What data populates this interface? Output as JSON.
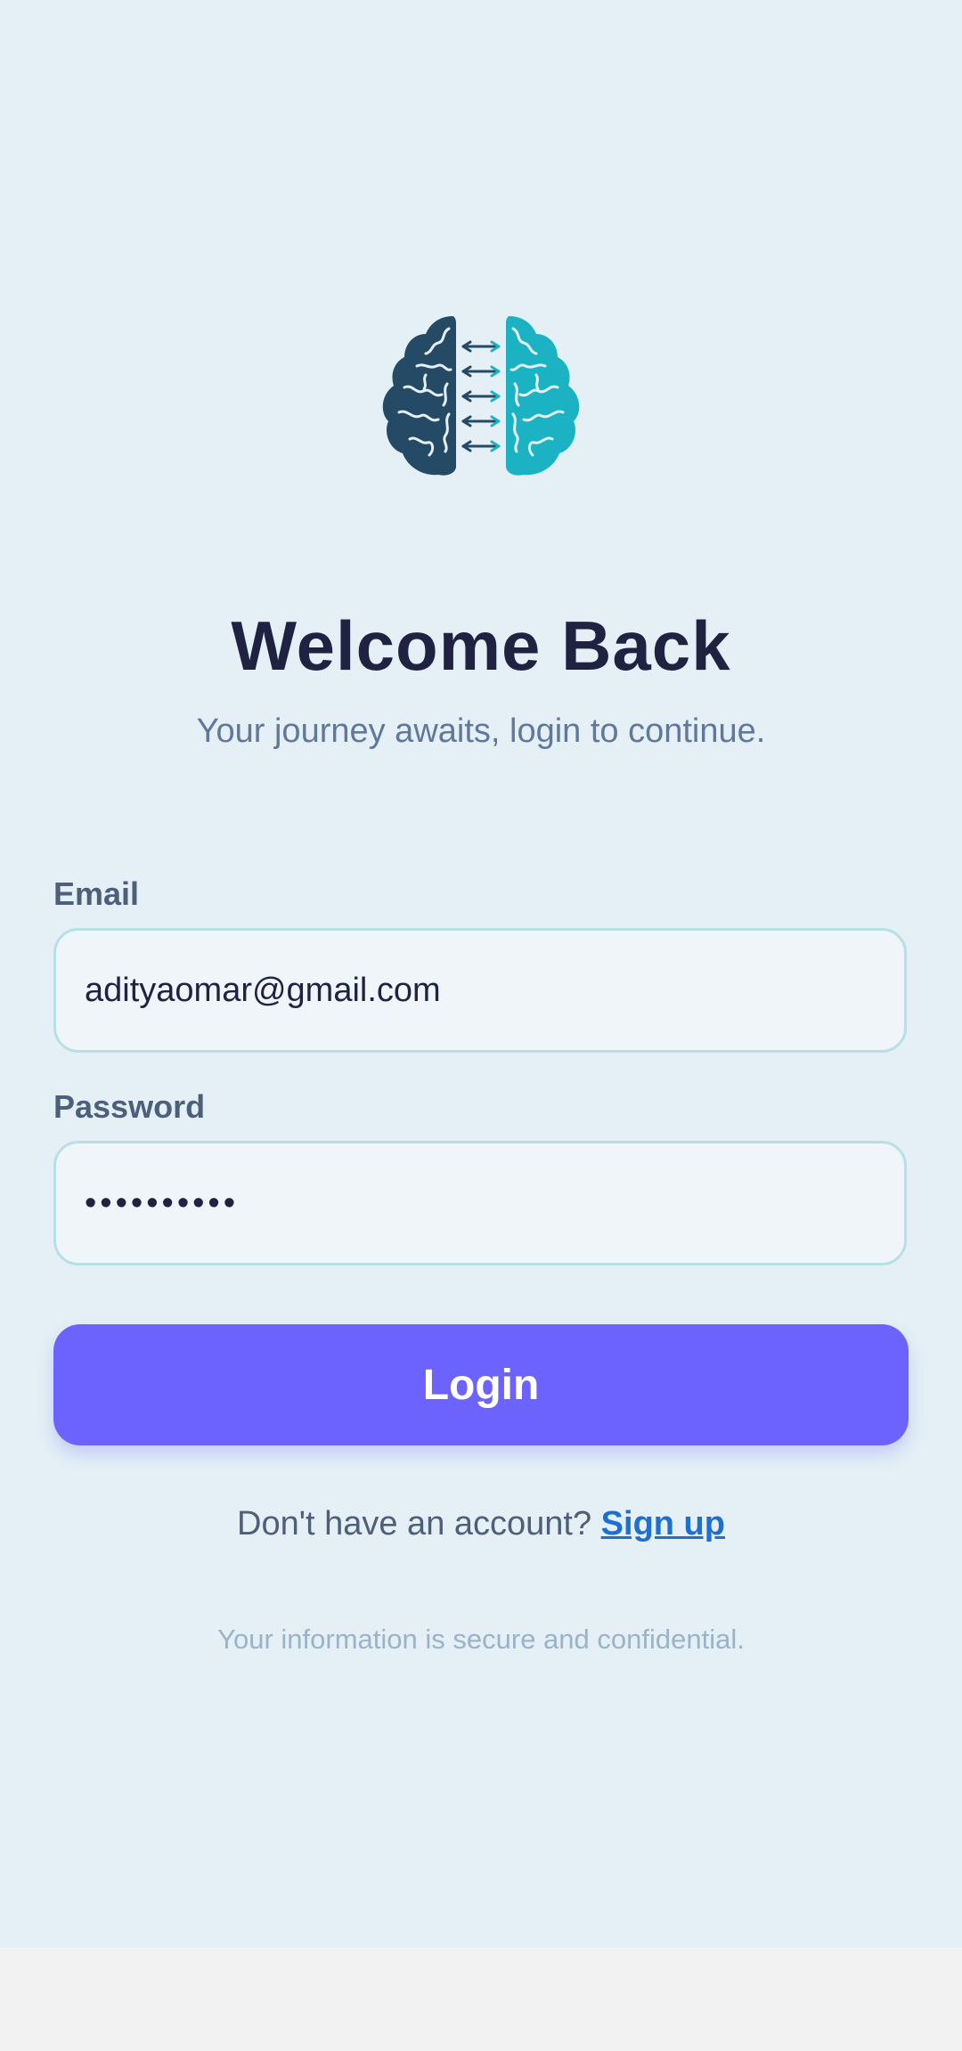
{
  "app": {
    "logo_icon": "brain-connection-icon",
    "colors": {
      "background": "#e4f0f5",
      "primary": "#6c63ff",
      "title": "#1f2341",
      "link": "#1e6fd0",
      "brain_left": "#244a66",
      "brain_right": "#1bb3c4"
    }
  },
  "header": {
    "title": "Welcome Back",
    "subtitle": "Your journey awaits, login to continue."
  },
  "form": {
    "email_label": "Email",
    "email_value": "adityaomar@gmail.com",
    "password_label": "Password",
    "password_value": "••••••••••",
    "login_label": "Login"
  },
  "footer": {
    "signup_prompt": "Don't have an account?",
    "signup_link": "Sign up",
    "secure_note": "Your information is secure and confidential."
  }
}
